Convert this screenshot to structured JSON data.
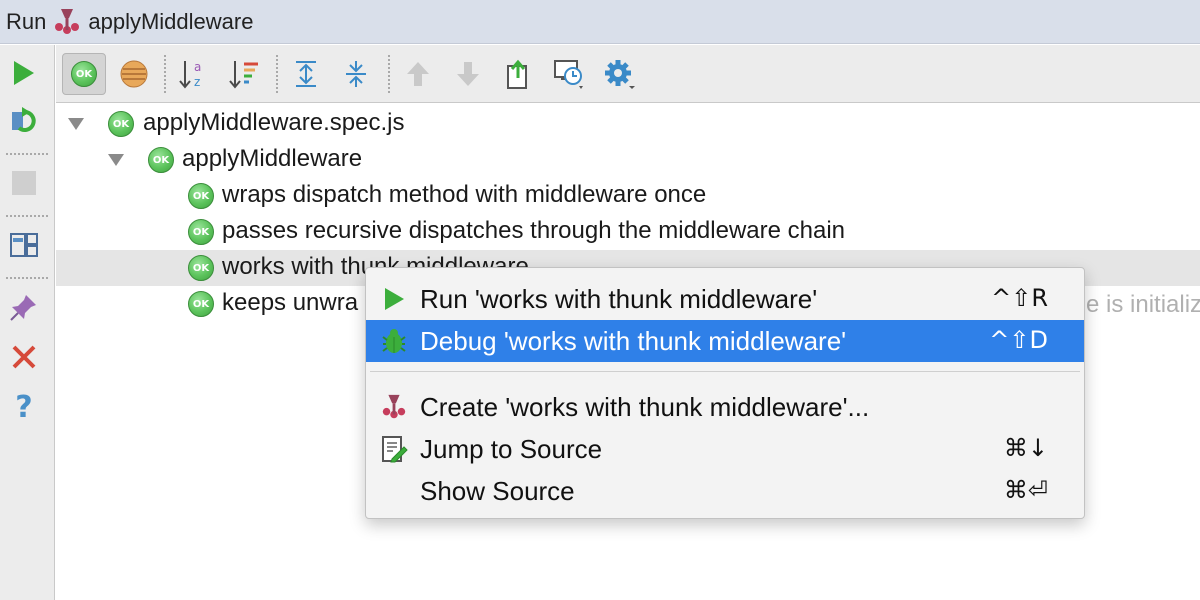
{
  "window": {
    "run_label": "Run",
    "tab_name": "applyMiddleware"
  },
  "left_toolbar": {
    "icons": [
      "run-icon",
      "rerun-icon",
      "stop-icon",
      "layout-icon",
      "pin-icon",
      "close-icon",
      "help-icon"
    ]
  },
  "top_toolbar": {
    "icons": [
      "show-passed-icon",
      "show-ignored-icon",
      "sort-alphabetically-icon",
      "sort-by-duration-icon",
      "expand-all-icon",
      "collapse-all-icon",
      "previous-failed-icon",
      "next-failed-icon",
      "export-icon",
      "import-icon",
      "settings-icon"
    ]
  },
  "badge_text": "OK",
  "tree": {
    "rows": [
      {
        "label": "applyMiddleware.spec.js",
        "status": "ok"
      },
      {
        "label": "applyMiddleware",
        "status": "ok"
      },
      {
        "label": "wraps dispatch method with middleware once",
        "status": "ok"
      },
      {
        "label": "passes recursive dispatches through the middleware chain",
        "status": "ok"
      },
      {
        "label": "works with thunk middleware",
        "status": "ok"
      },
      {
        "label": "keeps unwra",
        "status": "ok"
      }
    ],
    "selected_row": "works with thunk middleware",
    "obscured_fragment": "e is initializing"
  },
  "context_menu": {
    "items": [
      {
        "label": "Run 'works with thunk middleware'",
        "shortcut": "^⇧R",
        "icon": "run-icon"
      },
      {
        "label": "Debug 'works with thunk middleware'",
        "shortcut": "^⇧D",
        "icon": "debug-bug-icon",
        "highlighted": true
      },
      {
        "label": "Create 'works with thunk middleware'...",
        "shortcut": "",
        "icon": "jest-config-icon"
      },
      {
        "label": "Jump to Source",
        "shortcut": "⌘↓",
        "icon": "jump-to-source-icon"
      },
      {
        "label": "Show Source",
        "shortcut": "⌘⏎",
        "icon": ""
      }
    ]
  },
  "colors": {
    "highlight": "#2f80e8",
    "ok_green": "#5cc35c",
    "titlebar": "#d9dfea"
  }
}
